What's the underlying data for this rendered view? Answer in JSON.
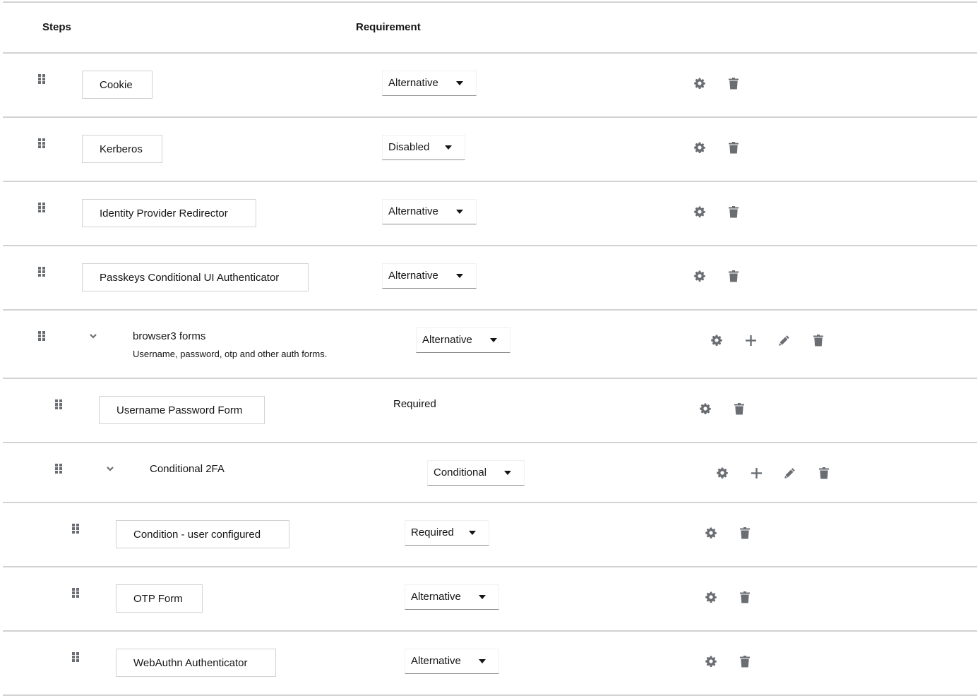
{
  "header": {
    "steps_label": "Steps",
    "requirement_label": "Requirement"
  },
  "colors": {
    "icon": "#6a6e73",
    "divider": "#d2d2d2",
    "text": "#151515"
  },
  "rows": [
    {
      "name": "Cookie",
      "type": "execution",
      "level": 0,
      "requirement": "Alternative",
      "requirement_editable": true,
      "actions": [
        "gear-icon",
        "trash-icon"
      ]
    },
    {
      "name": "Kerberos",
      "type": "execution",
      "level": 0,
      "requirement": "Disabled",
      "requirement_editable": true,
      "actions": [
        "gear-icon",
        "trash-icon"
      ]
    },
    {
      "name": "Identity Provider Redirector",
      "type": "execution",
      "level": 0,
      "requirement": "Alternative",
      "requirement_editable": true,
      "actions": [
        "gear-icon",
        "trash-icon"
      ]
    },
    {
      "name": "Passkeys Conditional UI Authenticator",
      "type": "execution",
      "level": 0,
      "requirement": "Alternative",
      "requirement_editable": true,
      "actions": [
        "gear-icon",
        "trash-icon"
      ]
    },
    {
      "name": "browser3 forms",
      "description": "Username, password, otp and other auth forms.",
      "type": "subflow",
      "expanded": true,
      "level": 0,
      "requirement": "Alternative",
      "requirement_editable": true,
      "actions": [
        "gear-icon",
        "plus-icon",
        "pencil-icon",
        "trash-icon"
      ]
    },
    {
      "name": "Username Password Form",
      "type": "execution",
      "level": 1,
      "requirement": "Required",
      "requirement_editable": false,
      "actions": [
        "gear-icon",
        "trash-icon"
      ]
    },
    {
      "name": "Conditional 2FA",
      "type": "subflow",
      "expanded": true,
      "level": 1,
      "requirement": "Conditional",
      "requirement_editable": true,
      "actions": [
        "gear-icon",
        "plus-icon",
        "pencil-icon",
        "trash-icon"
      ]
    },
    {
      "name": "Condition - user configured",
      "type": "execution",
      "level": 2,
      "requirement": "Required",
      "requirement_editable": true,
      "actions": [
        "gear-icon",
        "trash-icon"
      ]
    },
    {
      "name": "OTP Form",
      "type": "execution",
      "level": 2,
      "requirement": "Alternative",
      "requirement_editable": true,
      "actions": [
        "gear-icon",
        "trash-icon"
      ]
    },
    {
      "name": "WebAuthn Authenticator",
      "type": "execution",
      "level": 2,
      "requirement": "Alternative",
      "requirement_editable": true,
      "actions": [
        "gear-icon",
        "trash-icon"
      ]
    }
  ]
}
